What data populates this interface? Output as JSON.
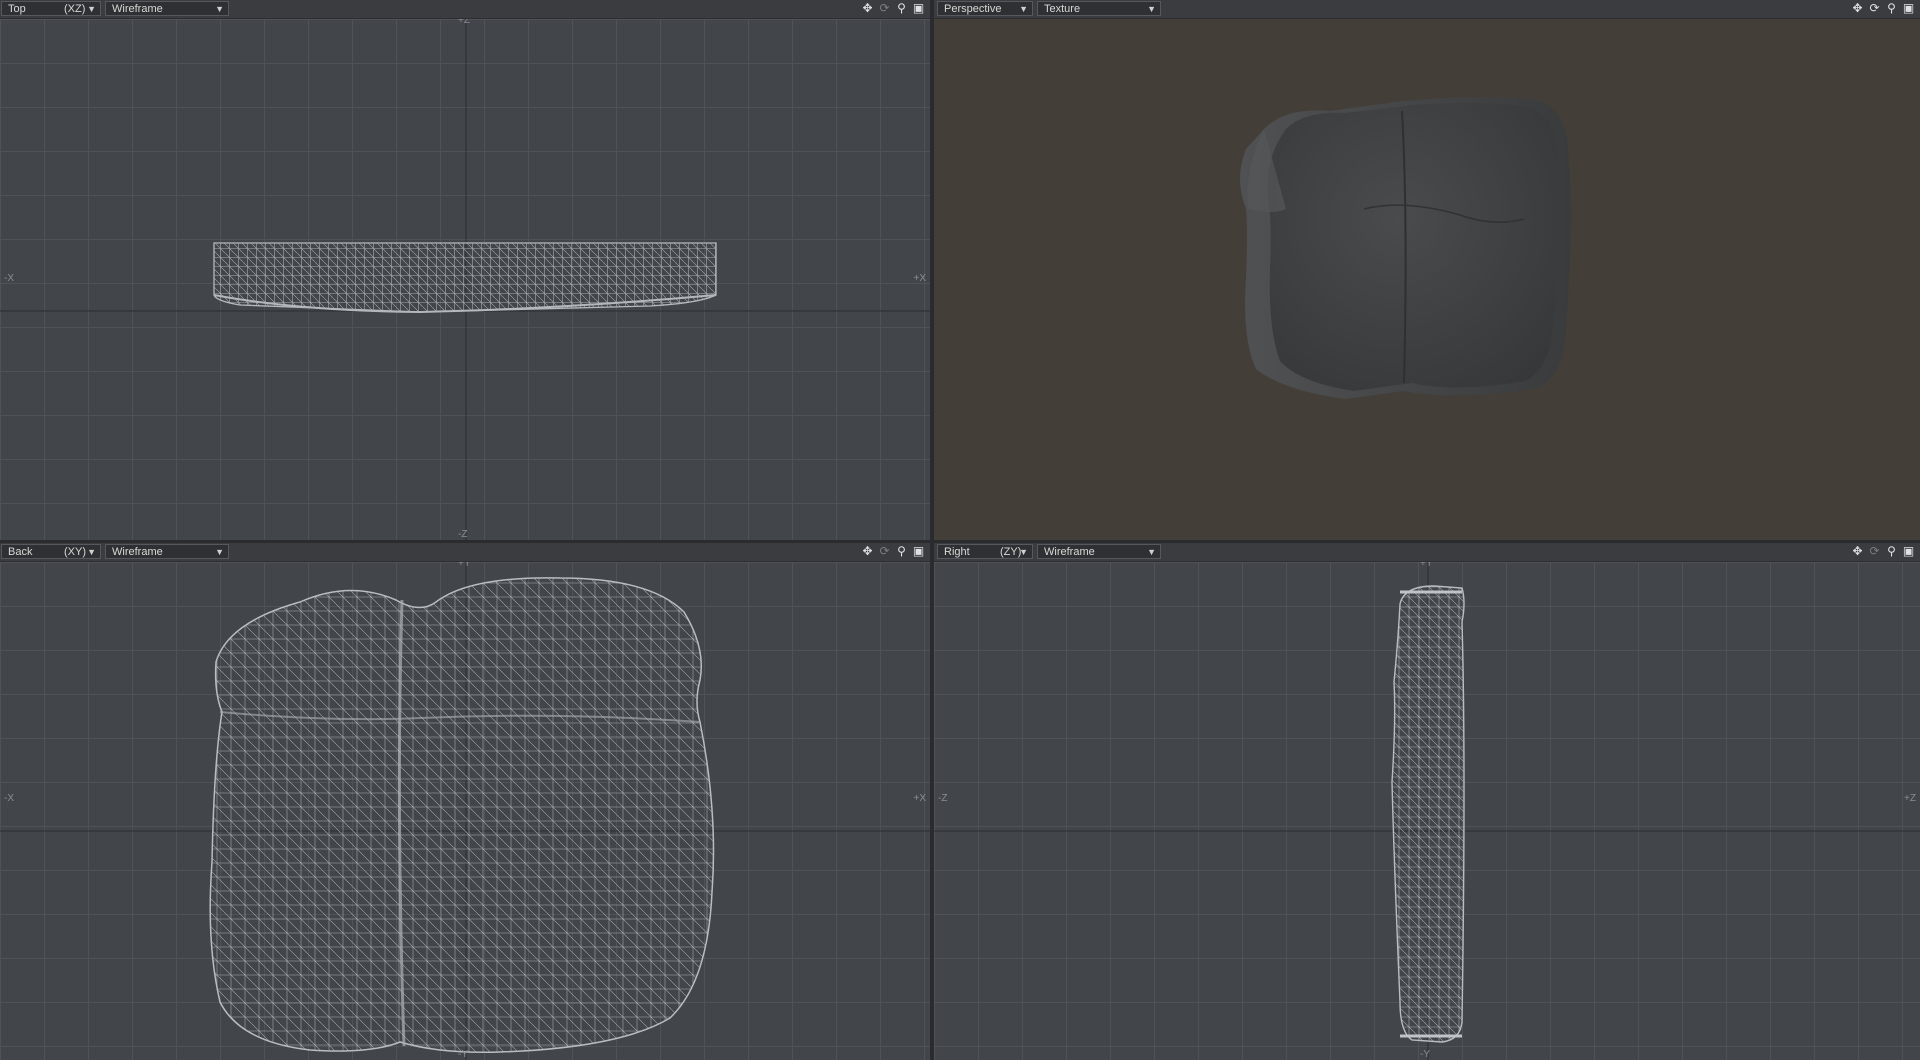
{
  "viewports": {
    "top": {
      "view": "Top",
      "plane": "(XZ)",
      "mode": "Wireframe",
      "axes": {
        "left": "-X",
        "right": "+X",
        "top": "+Z",
        "bottom": "-Z"
      }
    },
    "perspective": {
      "view": "Perspective",
      "mode": "Texture"
    },
    "back": {
      "view": "Back",
      "plane": "(XY)",
      "mode": "Wireframe",
      "axes": {
        "left": "-X",
        "right": "+X",
        "top": "+Y",
        "bottom": "-Y"
      }
    },
    "right": {
      "view": "Right",
      "plane": "(ZY)",
      "mode": "Wireframe",
      "axes": {
        "left": "-Z",
        "right": "+Z",
        "top": "+Y",
        "bottom": "-Y"
      }
    }
  },
  "toolbar_icons": [
    "move-icon",
    "rotate-icon",
    "zoom-icon",
    "maximize-icon"
  ],
  "colors": {
    "viewport_bg": "#42464b",
    "perspective_bg": "#433e38",
    "grid": "#4f5358",
    "axis": "#2b2d30",
    "wire": "#a9adb1",
    "model": "#3f4042"
  }
}
